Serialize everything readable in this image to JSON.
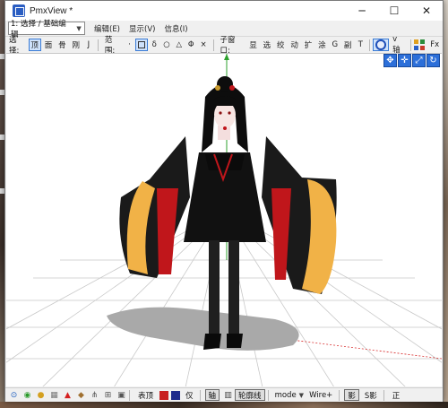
{
  "window": {
    "title": "PmxView *",
    "minimize": "─",
    "maximize": "☐",
    "close": "✕"
  },
  "menubar": {
    "mode_select": "1: 选择 / 基础编辑",
    "items": [
      "编辑(E)",
      "显示(V)",
      "信息(I)"
    ]
  },
  "toolbar": {
    "select_label": "选择:",
    "select_buttons": [
      "顶",
      "面",
      "骨",
      "刚",
      "J"
    ],
    "range_label": "范围:",
    "range_buttons": [
      "·",
      "□",
      "δ",
      "○",
      "△",
      "Φ",
      "×"
    ],
    "subwindow_label": "子窗口:",
    "subwindow_buttons": [
      "显",
      "选",
      "绞",
      "动",
      "扩",
      "涂",
      "G",
      "副",
      "T"
    ],
    "v_axis": "v轴",
    "fx": "Fx"
  },
  "statusbar": {
    "buttons_left": [
      "表顶",
      "仅",
      "轴",
      "轮廓线"
    ],
    "mode": "mode",
    "wire": "Wire+",
    "shadow_icon_label": "影",
    "s_shadow": "S影",
    "zheng": "正"
  },
  "colors": {
    "accent": "#2c6fd9",
    "swatch_red": "#c81e1e",
    "swatch_navy": "#1e2a8c",
    "axis_green": "#2ca02c",
    "axis_red": "#d93030"
  }
}
